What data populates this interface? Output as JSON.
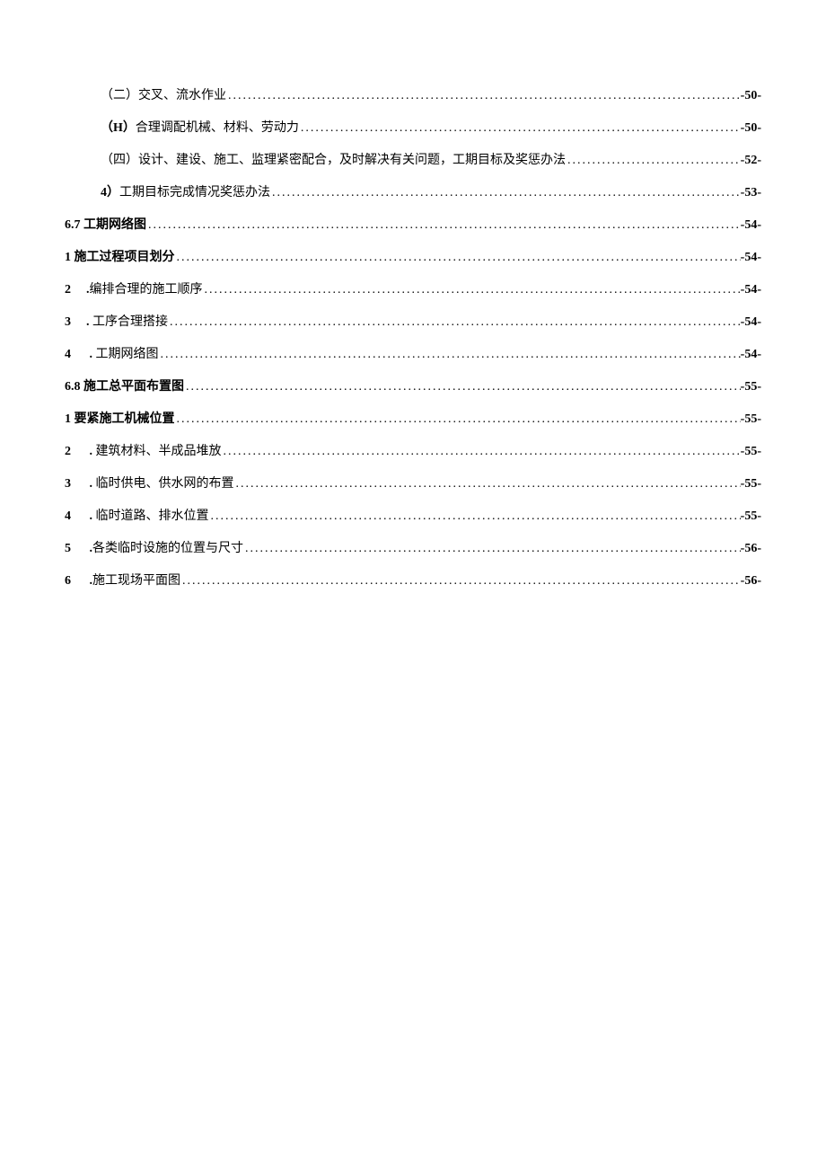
{
  "toc": [
    {
      "indent": 1,
      "bold": false,
      "text": "（二）交叉、流水作业",
      "page": "-50-"
    },
    {
      "indent": 1,
      "bold": false,
      "prefixBold": true,
      "prefix": "（H）",
      "text": "合理调配机械、材料、劳动力",
      "page": "-50-"
    },
    {
      "indent": 1,
      "bold": false,
      "text": "（四）设计、建设、施工、监理紧密配合，及时解决有关问题，工期目标及奖惩办法",
      "page": "-52-"
    },
    {
      "indent": 1,
      "bold": false,
      "prefixBold": true,
      "prefix": "4）",
      "text": "工期目标完成情况奖惩办法",
      "page": "-53-"
    },
    {
      "indent": 0,
      "bold": true,
      "text": "6.7 工期网络图",
      "page": "-54-"
    },
    {
      "indent": 0,
      "bold": true,
      "text": "1 施工过程项目划分 ",
      "page": "-54-"
    },
    {
      "indent": 0,
      "bold": false,
      "numPrefix": "2",
      "dot": ".",
      "text": "编排合理的施工顺序 ",
      "page": "-54-"
    },
    {
      "indent": 0,
      "bold": false,
      "numPrefix": "3",
      "dot": ". ",
      "text": "工序合理搭接 ",
      "page": "-54-"
    },
    {
      "indent": 0,
      "bold": false,
      "numPrefix": "4",
      "dot": " . ",
      "text": "工期网络图",
      "page": "-54-"
    },
    {
      "indent": 0,
      "bold": true,
      "text": "6.8 施工总平面布置图",
      "page": "-55-"
    },
    {
      "indent": 0,
      "bold": true,
      "text": "1 要紧施工机械位置 ",
      "page": "-55-"
    },
    {
      "indent": 0,
      "bold": false,
      "numPrefix": "2",
      "dot": " . ",
      "text": "建筑材料、半成品堆放",
      "page": "-55-"
    },
    {
      "indent": 0,
      "bold": false,
      "numPrefix": "3",
      "dot": " . ",
      "text": "临时供电、供水网的布置",
      "page": "-55-"
    },
    {
      "indent": 0,
      "bold": false,
      "numPrefix": "4",
      "dot": " . ",
      "text": "临时道路、排水位置",
      "page": "-55-"
    },
    {
      "indent": 0,
      "bold": false,
      "numPrefix": "5",
      "dot": " .",
      "text": "各类临时设施的位置与尺寸 ",
      "page": "-56-"
    },
    {
      "indent": 0,
      "bold": false,
      "numPrefix": "6",
      "dot": " .",
      "text": "施工现场平面图 ",
      "page": "-56-"
    }
  ],
  "dots": "................................................................................................................................................................"
}
